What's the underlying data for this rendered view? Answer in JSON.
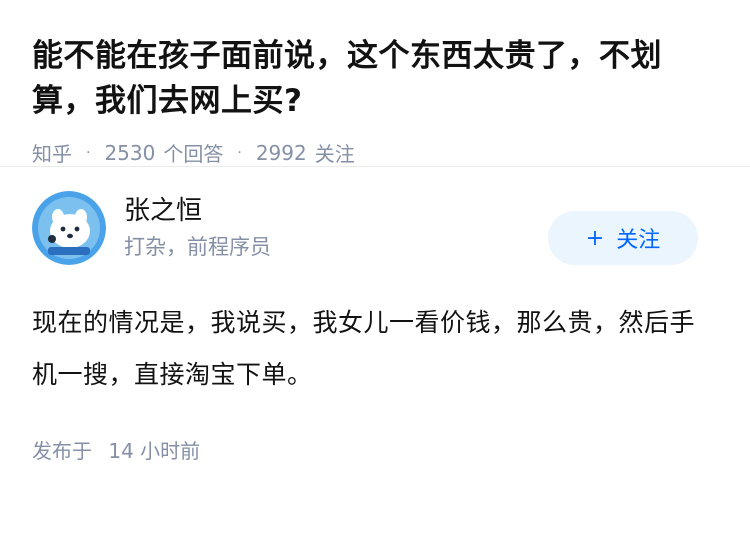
{
  "question": {
    "title": "能不能在孩子面前说，这个东西太贵了，不划算，我们去网上买?",
    "source": "知乎",
    "answer_count": "2530",
    "answer_label": "个回答",
    "follower_count": "2992",
    "follower_label": "关注"
  },
  "author": {
    "name": "张之恒",
    "headline": "打杂，前程序员",
    "follow_icon": "+",
    "follow_label": "关注"
  },
  "answer": {
    "content": "现在的情况是，我说买，我女儿一看价钱，那么贵，然后手机一搜，直接淘宝下单。",
    "time_prefix": "发布于",
    "time_value": "14 小时前"
  },
  "colors": {
    "accent": "#0066ff",
    "follow_bg": "#ebf5fd",
    "meta": "#8590a6",
    "avatar_bg": "#4aa3e8"
  }
}
